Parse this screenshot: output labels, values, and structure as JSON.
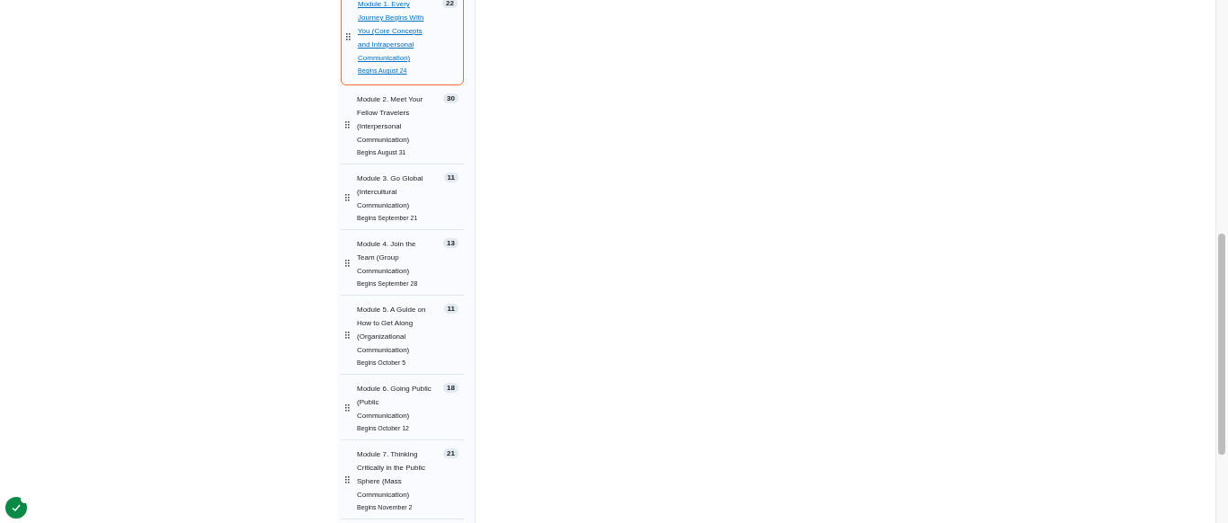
{
  "modules": [
    {
      "title": "Module 1. Every Journey Begins With You (Core Concepts and Intrapersonal Communication)",
      "date": "Begins August 24",
      "count": "22",
      "selected": true
    },
    {
      "title": "Module 2. Meet Your Fellow Travelers (Interpersonal Communication)",
      "date": "Begins August 31",
      "count": "30",
      "selected": false
    },
    {
      "title": "Module 3. Go Global (Intercultural Communication)",
      "date": "Begins September 21",
      "count": "11",
      "selected": false
    },
    {
      "title": "Module 4. Join the Team (Group Communication)",
      "date": "Begins September 28",
      "count": "13",
      "selected": false
    },
    {
      "title": "Module 5. A Guide on How to Get Along (Organizational Communication)",
      "date": "Begins October 5",
      "count": "11",
      "selected": false
    },
    {
      "title": "Module 6. Going Public (Public Communication)",
      "date": "Begins October 12",
      "count": "18",
      "selected": false
    },
    {
      "title": "Module 7. Thinking Critically in the Public Sphere (Mass Communication)",
      "date": "Begins November 2",
      "count": "21",
      "selected": false
    }
  ]
}
